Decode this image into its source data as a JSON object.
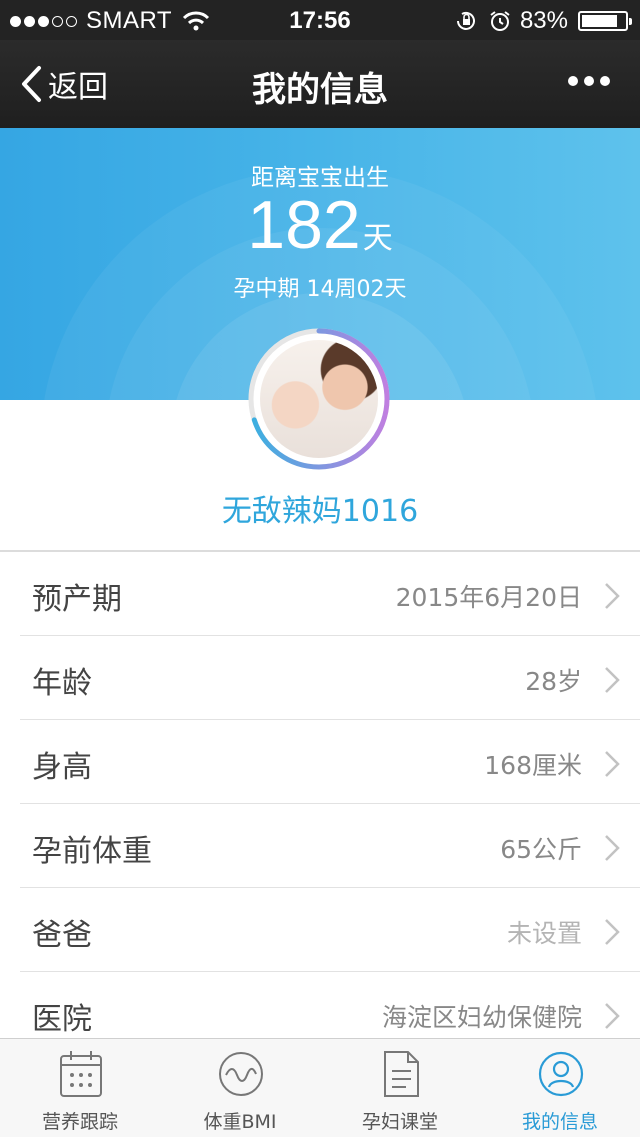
{
  "status_bar": {
    "carrier": "SMART",
    "time": "17:56",
    "battery": "83%",
    "battery_level": 0.83,
    "signal_bars_filled": 3,
    "signal_bars_total": 5
  },
  "nav": {
    "back_label": "返回",
    "title": "我的信息"
  },
  "hero": {
    "label": "距离宝宝出生",
    "days": "182",
    "days_unit": "天",
    "phase": "孕中期 14周02天",
    "progress": 0.7
  },
  "profile": {
    "username": "无敌辣妈1016"
  },
  "rows": [
    {
      "label": "预产期",
      "value": "2015年6月20日",
      "muted": false
    },
    {
      "label": "年龄",
      "value": "28岁",
      "muted": false
    },
    {
      "label": "身高",
      "value": "168厘米",
      "muted": false
    },
    {
      "label": "孕前体重",
      "value": "65公斤",
      "muted": false
    },
    {
      "label": "爸爸",
      "value": "未设置",
      "muted": true
    },
    {
      "label": "医院",
      "value": "海淀区妇幼保健院",
      "muted": false
    }
  ],
  "tabs": [
    {
      "label": "营养跟踪",
      "icon": "calendar-icon",
      "active": false
    },
    {
      "label": "体重BMI",
      "icon": "wave-icon",
      "active": false
    },
    {
      "label": "孕妇课堂",
      "icon": "document-icon",
      "active": false
    },
    {
      "label": "我的信息",
      "icon": "user-icon",
      "active": true
    }
  ],
  "colors": {
    "accent": "#2a9bd6",
    "hero_blue": "#3ea9e5",
    "ring_gradient": [
      "#3ab0e0",
      "#c07fe0"
    ]
  }
}
